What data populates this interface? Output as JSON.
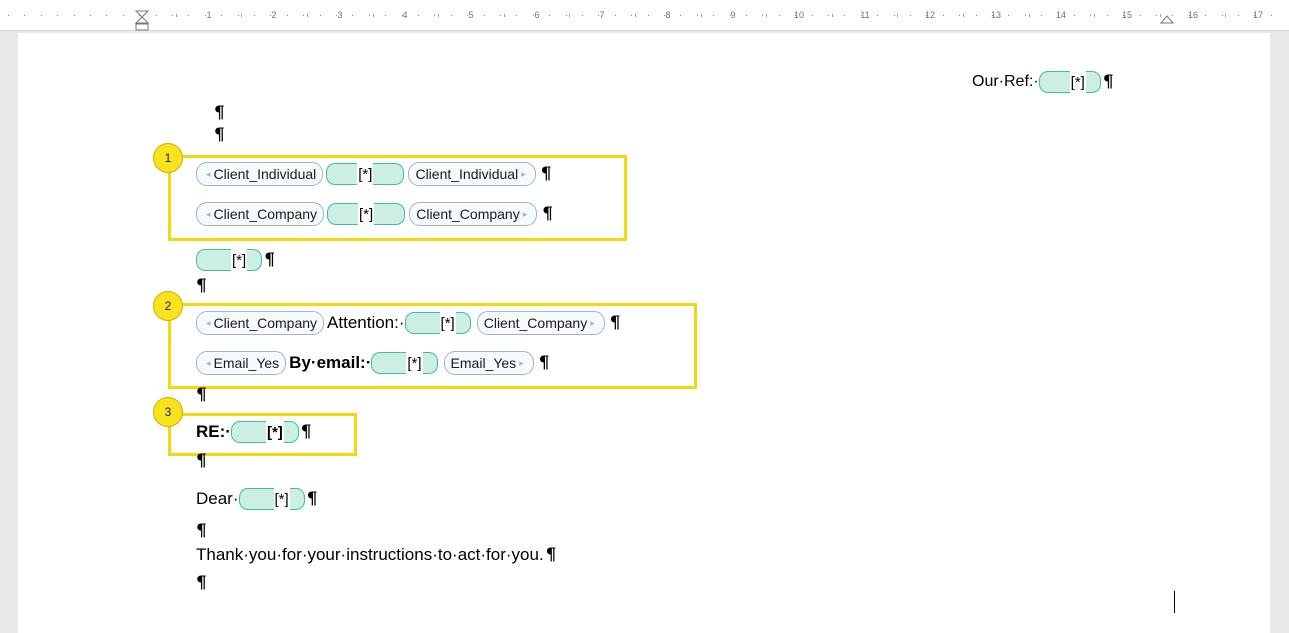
{
  "ruler": {
    "numbers": [
      "1",
      "2",
      "3",
      "4",
      "5",
      "6",
      "7",
      "8",
      "9",
      "10",
      "11",
      "12",
      "13",
      "14",
      "15",
      "16",
      "17"
    ]
  },
  "placeholder": "[*]",
  "para_mark": "¶",
  "doc": {
    "our_ref_label": "Our·Ref:·",
    "client_individual": "Client_Individual",
    "client_company": "Client_Company",
    "attention_label": "Attention:·",
    "email_yes": "Email_Yes",
    "by_email_label": "By·email:·",
    "re_label": "RE:·",
    "dear_label": "Dear·",
    "thank_you": "Thank·you·for·your·instructions·to·act·for·you."
  },
  "badges": [
    "1",
    "2",
    "3"
  ],
  "colors": {
    "highlight": "#f4d80c",
    "badge": "#f8e31e",
    "placeholder_fill": "#cdeee5",
    "placeholder_border": "#3fbf9f",
    "tag_border": "#9fb6c7"
  }
}
